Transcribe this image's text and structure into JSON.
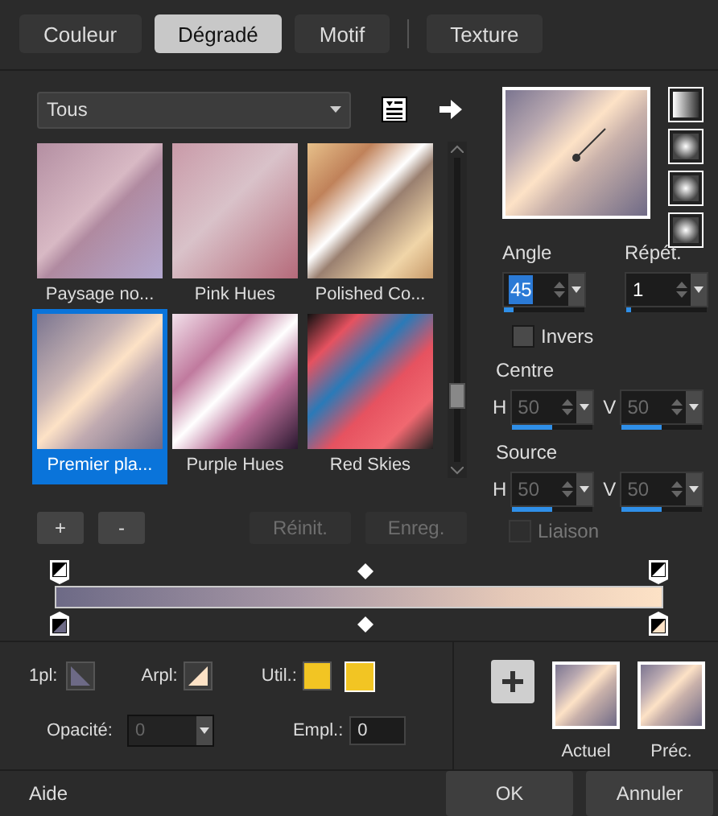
{
  "tabs": [
    {
      "label": "Couleur",
      "selected": false
    },
    {
      "label": "Dégradé",
      "selected": true
    },
    {
      "label": "Motif",
      "selected": false
    },
    {
      "label": "Texture",
      "selected": false
    }
  ],
  "category": {
    "value": "Tous"
  },
  "gradients": [
    {
      "label": "Paysage no...",
      "selected": false
    },
    {
      "label": "Pink Hues",
      "selected": false
    },
    {
      "label": "Polished Co...",
      "selected": false
    },
    {
      "label": "Premier pla...",
      "selected": true
    },
    {
      "label": "Purple Hues",
      "selected": false
    },
    {
      "label": "Red Skies",
      "selected": false
    }
  ],
  "angle": {
    "label": "Angle",
    "value": "45",
    "level": 0.12
  },
  "repeat": {
    "label": "Répét.",
    "value": "1",
    "level": 0.05
  },
  "invert": {
    "label": "Invers",
    "checked": false
  },
  "centre": {
    "label": "Centre",
    "h_label": "H",
    "h": {
      "value": "50",
      "level": 0.5,
      "disabled": true
    },
    "v_label": "V",
    "v": {
      "value": "50",
      "level": 0.5,
      "disabled": true
    }
  },
  "source": {
    "label": "Source",
    "h_label": "H",
    "h": {
      "value": "50",
      "level": 0.5,
      "disabled": true
    },
    "v_label": "V",
    "v": {
      "value": "50",
      "level": 0.5,
      "disabled": true
    }
  },
  "link": {
    "label": "Liaison",
    "checked": false,
    "disabled": true
  },
  "stop_buttons": [
    {
      "label": "+",
      "disabled": false
    },
    {
      "label": "-",
      "disabled": false
    },
    {
      "label": "Réinit.",
      "disabled": true
    },
    {
      "label": "Enreg.",
      "disabled": true
    }
  ],
  "colors": {
    "fg_label": "1pl:",
    "bg_label": "Arpl:",
    "user_label": "Util.:"
  },
  "opacity": {
    "label": "Opacité:",
    "value": "0",
    "disabled": true
  },
  "location": {
    "label": "Empl.:",
    "value": "0"
  },
  "swatches": [
    {
      "label": "Actuel"
    },
    {
      "label": "Préc."
    }
  ],
  "footer": {
    "help": "Aide",
    "buttons": [
      "OK",
      "Annuler"
    ]
  }
}
